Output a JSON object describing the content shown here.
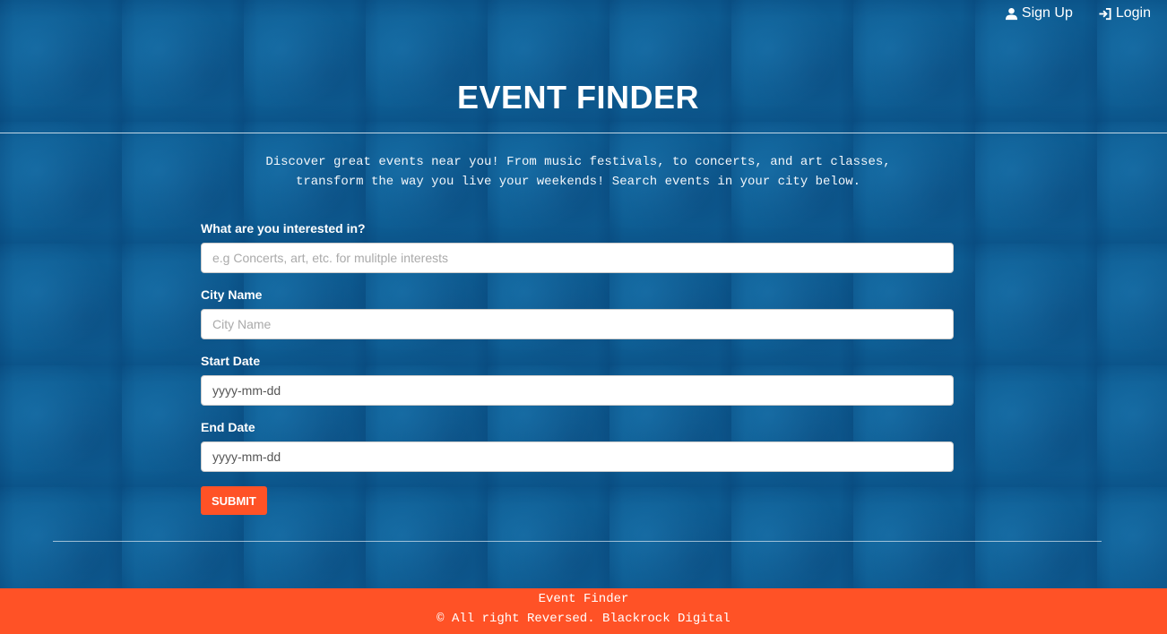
{
  "nav": {
    "signup_label": "Sign Up",
    "login_label": "Login",
    "signup_icon": "user-icon",
    "login_icon": "login-icon"
  },
  "header": {
    "title": "EVENT FINDER"
  },
  "intro": {
    "line1": "Discover great events near you! From music festivals, to concerts, and art classes,",
    "line2": "transform the way you live your weekends! Search events in your city below."
  },
  "form": {
    "interests": {
      "label": "What are you interested in?",
      "placeholder": "e.g Concerts, art, etc. for mulitple interests",
      "value": ""
    },
    "city": {
      "label": "City Name",
      "placeholder": "City Name",
      "value": ""
    },
    "start_date": {
      "label": "Start Date",
      "placeholder": "yyyy-mm-dd",
      "value": ""
    },
    "end_date": {
      "label": "End Date",
      "placeholder": "yyyy-mm-dd",
      "value": ""
    },
    "submit_label": "SUBMIT"
  },
  "footer": {
    "line1": "Event Finder",
    "line2": "© All right Reversed. Blackrock Digital"
  },
  "colors": {
    "accent": "#ff5226",
    "background": "#0d5c92"
  }
}
